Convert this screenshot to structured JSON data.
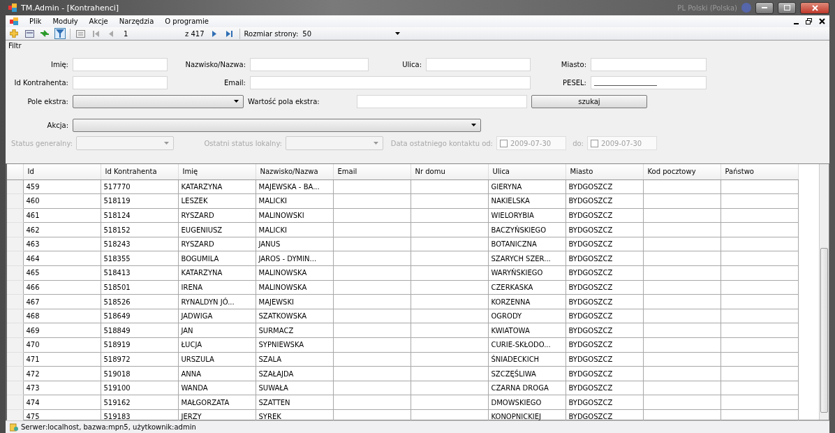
{
  "window": {
    "title": "TM.Admin - [Kontrahenci]",
    "language": "PL Polski (Polska)"
  },
  "menu": [
    "Plik",
    "Moduły",
    "Akcje",
    "Narzędzia",
    "O programie"
  ],
  "toolbar": {
    "filter_selected": true,
    "page": "1",
    "page_count": "z 417",
    "page_size_label": "Rozmiar strony:",
    "page_size": "50"
  },
  "filter": {
    "title": "Filtr",
    "rows": [
      [
        {
          "label": "Imię:",
          "kind": "text"
        },
        {
          "label": "Nazwisko/Nazwa:",
          "kind": "text"
        },
        {
          "label": "Ulica:",
          "kind": "text"
        },
        {
          "label": "Miasto:",
          "kind": "text"
        }
      ],
      [
        {
          "label": "Id Kontrahenta:",
          "kind": "text"
        },
        {
          "label": "Email:",
          "kind": "wide"
        },
        "",
        {
          "label": "PESEL:",
          "kind": "masked"
        }
      ]
    ],
    "extra_label": "Pole ekstra:",
    "extra_value_label": "Wartość pola ekstra:",
    "search_button": "szukaj",
    "action_label": "Akcja:",
    "status": {
      "disabled": true,
      "general_label": "Status generalny:",
      "local_label": "Ostatni status lokalny:",
      "date_label": "Data ostatniego kontaktu od:",
      "date_from": "2009-07-30",
      "date_from_checked": false,
      "to_label": "do:",
      "date_to": "2009-07-30",
      "date_to_checked": false
    }
  },
  "table": {
    "columns": [
      "Id",
      "Id Kontrahenta",
      "Imię",
      "Nazwisko/Nazwa",
      "Email",
      "Nr domu",
      "Ulica",
      "Miasto",
      "Kod pocztowy",
      "Państwo"
    ],
    "rows": [
      [
        "459",
        "517770",
        "KATARZYNA",
        "MAJEWSKA - BA...",
        "",
        "",
        "GIERYNA",
        "BYDGOSZCZ",
        "",
        ""
      ],
      [
        "460",
        "518119",
        "LESZEK",
        "MALICKI",
        "",
        "",
        "NAKIELSKA",
        "BYDGOSZCZ",
        "",
        ""
      ],
      [
        "461",
        "518124",
        "RYSZARD",
        "MALINOWSKI",
        "",
        "",
        "WIELORYBIA",
        "BYDGOSZCZ",
        "",
        ""
      ],
      [
        "462",
        "518152",
        "EUGENIUSZ",
        "MALICKI",
        "",
        "",
        "BACZYŃSKIEGO",
        "BYDGOSZCZ",
        "",
        ""
      ],
      [
        "463",
        "518243",
        "RYSZARD",
        "JANUS",
        "",
        "",
        "BOTANICZNA",
        "BYDGOSZCZ",
        "",
        ""
      ],
      [
        "464",
        "518355",
        "BOGUMILA",
        "JAROS - DYMIN...",
        "",
        "",
        "SZARYCH SZER...",
        "BYDGOSZCZ",
        "",
        ""
      ],
      [
        "465",
        "518413",
        "KATARZYNA",
        "MALINOWSKA",
        "",
        "",
        "WARYŃSKIEGO",
        "BYDGOSZCZ",
        "",
        ""
      ],
      [
        "466",
        "518501",
        "IRENA",
        "MALINOWSKA",
        "",
        "",
        "CZERKASKA",
        "BYDGOSZCZ",
        "",
        ""
      ],
      [
        "467",
        "518526",
        "RYNALDYN JÓ...",
        "MAJEWSKI",
        "",
        "",
        "KORZENNA",
        "BYDGOSZCZ",
        "",
        ""
      ],
      [
        "468",
        "518649",
        "JADWIGA",
        "SZATKOWSKA",
        "",
        "",
        "OGRODY",
        "BYDGOSZCZ",
        "",
        ""
      ],
      [
        "469",
        "518849",
        "JAN",
        "SURMACZ",
        "",
        "",
        "KWIATOWA",
        "BYDGOSZCZ",
        "",
        ""
      ],
      [
        "470",
        "518919",
        "ŁUCJA",
        "SYPNIEWSKA",
        "",
        "",
        "CURIE-SKŁODO...",
        "BYDGOSZCZ",
        "",
        ""
      ],
      [
        "471",
        "518972",
        "URSZULA",
        "SZALA",
        "",
        "",
        "ŚNIADECKICH",
        "BYDGOSZCZ",
        "",
        ""
      ],
      [
        "472",
        "519018",
        "ANNA",
        "SZAŁAJDA",
        "",
        "",
        "SZCZĘŚLIWA",
        "BYDGOSZCZ",
        "",
        ""
      ],
      [
        "473",
        "519100",
        "WANDA",
        "SUWAŁA",
        "",
        "",
        "CZARNA DROGA",
        "BYDGOSZCZ",
        "",
        ""
      ],
      [
        "474",
        "519162",
        "MAŁGORZATA",
        "SZATTEN",
        "",
        "",
        "DMOWSKIEGO",
        "BYDGOSZCZ",
        "",
        ""
      ],
      [
        "475",
        "519183",
        "JERZY",
        "SYREK",
        "",
        "",
        "KONOPNICKIEJ",
        "BYDGOSZCZ",
        "",
        ""
      ]
    ]
  },
  "status_bar": "Serwer:localhost, bazwa:mpn5, użytkownik:admin"
}
